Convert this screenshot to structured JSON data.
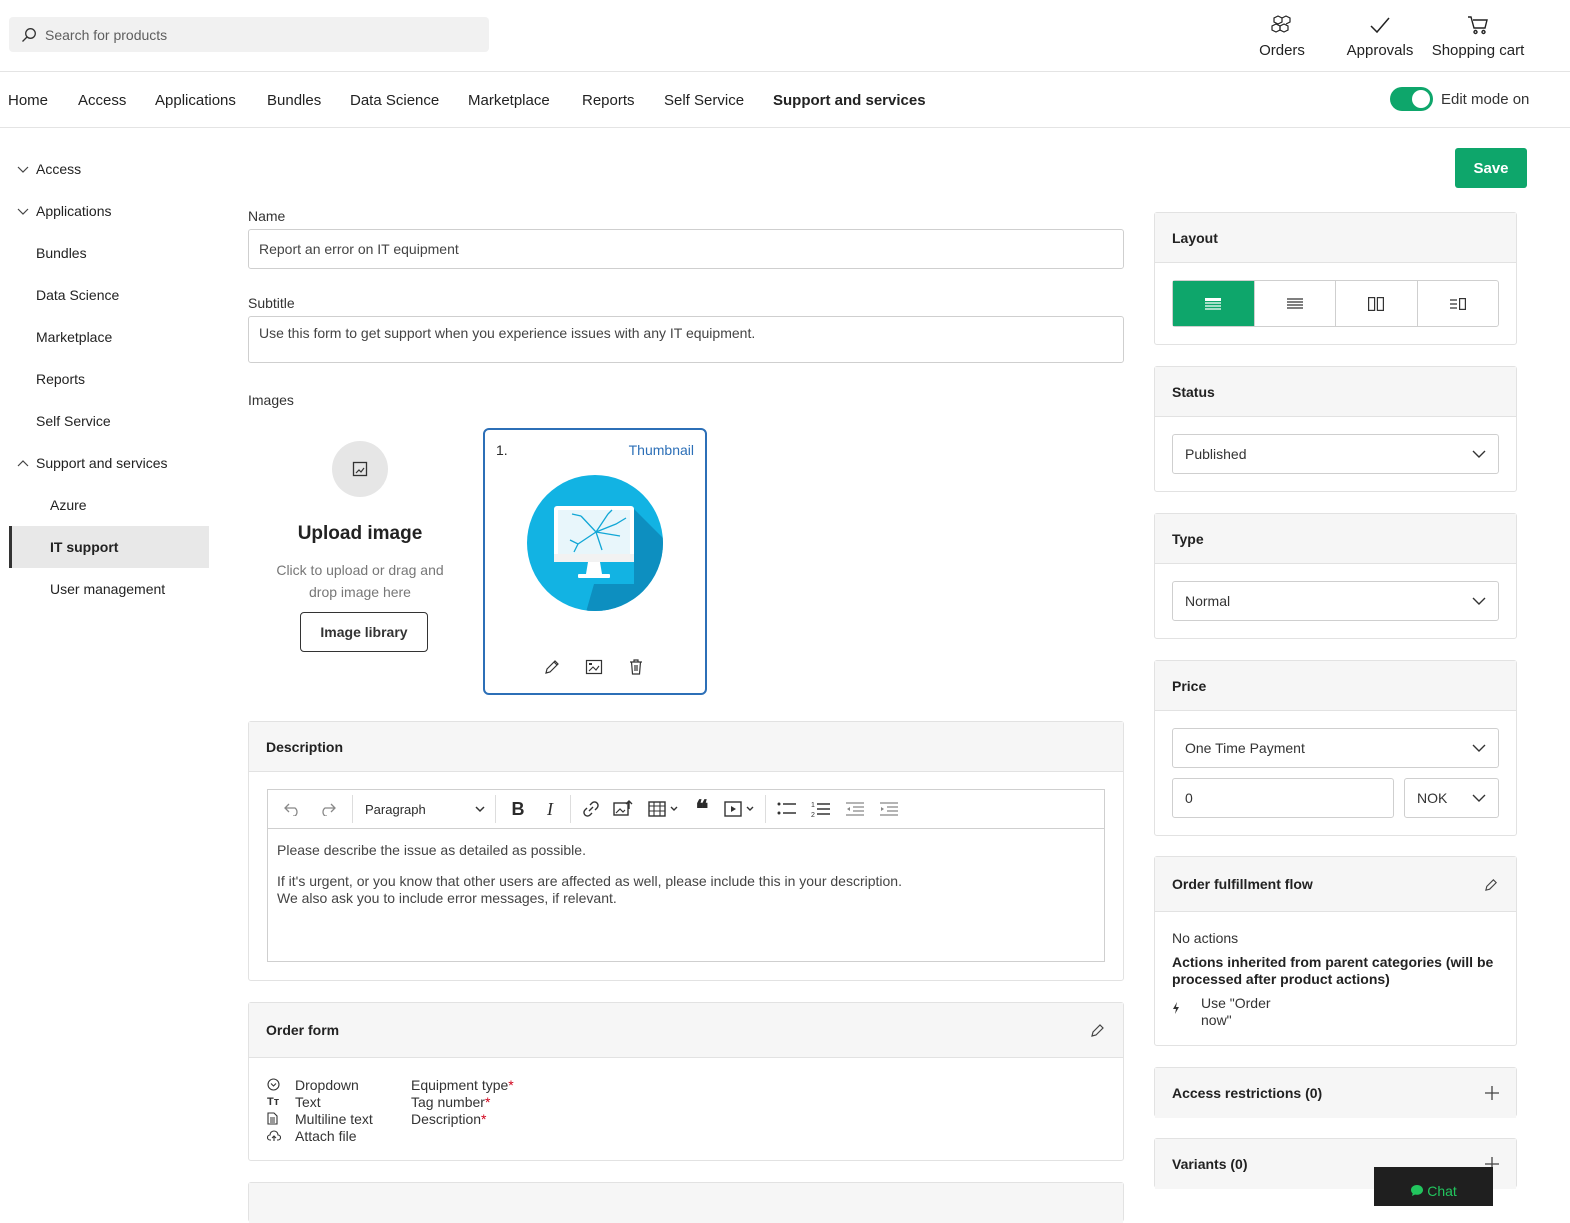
{
  "search": {
    "placeholder": "Search for products"
  },
  "topbar": {
    "orders": "Orders",
    "approvals": "Approvals",
    "cart": "Shopping cart"
  },
  "nav": [
    "Home",
    "Access",
    "Applications",
    "Bundles",
    "Data Science",
    "Marketplace",
    "Reports",
    "Self Service",
    "Support and services"
  ],
  "edit_mode": {
    "label": "Edit mode on",
    "on": true
  },
  "sidebar": {
    "items": [
      "Access",
      "Applications",
      "Bundles",
      "Data Science",
      "Marketplace",
      "Reports",
      "Self Service",
      "Support and services"
    ],
    "children": [
      "Azure",
      "IT support",
      "User management"
    ]
  },
  "save": "Save",
  "form": {
    "name_label": "Name",
    "name_value": "Report an error on IT equipment",
    "subtitle_label": "Subtitle",
    "subtitle_value": "Use this form to get support when you experience issues with any IT equipment.",
    "images_label": "Images"
  },
  "upload": {
    "title": "Upload image",
    "hint": "Click to upload or drag and drop image here",
    "library": "Image library"
  },
  "image_card": {
    "index": "1.",
    "tag": "Thumbnail"
  },
  "description": {
    "title": "Description",
    "format": "Paragraph",
    "line1": "Please describe the issue as detailed as possible.",
    "line2": "If it's urgent, or you know that other users are affected as well, please include this in your description.",
    "line3": "We also ask you to include error messages, if relevant."
  },
  "order_form": {
    "title": "Order form",
    "rows": [
      {
        "type": "Dropdown",
        "field": "Equipment type",
        "required": true
      },
      {
        "type": "Text",
        "field": "Tag number",
        "required": true
      },
      {
        "type": "Multiline text",
        "field": "Description",
        "required": true
      },
      {
        "type": "Attach file",
        "field": "",
        "required": false
      }
    ]
  },
  "layout": {
    "title": "Layout"
  },
  "status": {
    "title": "Status",
    "value": "Published"
  },
  "type": {
    "title": "Type",
    "value": "Normal"
  },
  "price": {
    "title": "Price",
    "mode": "One Time Payment",
    "amount": "0",
    "currency": "NOK"
  },
  "fulfillment": {
    "title": "Order fulfillment flow",
    "no_actions": "No actions",
    "inherited": "Actions inherited from parent categories (will be processed after product actions)",
    "action_line1": "Use \"Order",
    "action_line2": "now\""
  },
  "access_restrictions": "Access restrictions (0)",
  "variants": "Variants (0)",
  "chat": "Chat",
  "colors": {
    "accent": "#0ea66b",
    "selected_border": "#2c6fb7",
    "required": "#d0021b"
  }
}
